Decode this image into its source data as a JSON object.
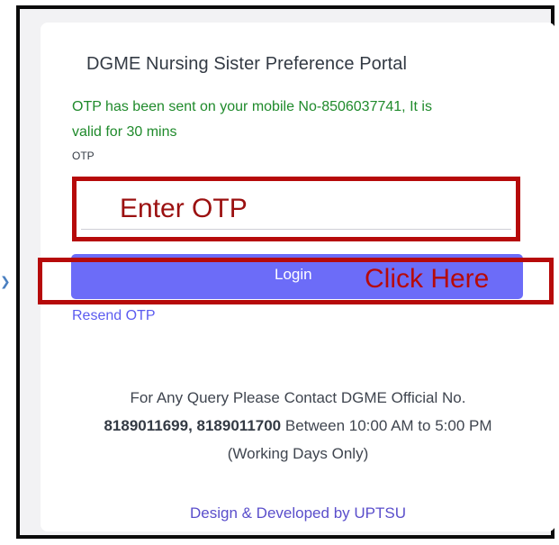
{
  "portal": {
    "title": "DGME Nursing Sister Preference Portal"
  },
  "otp": {
    "message": "OTP has been sent on your mobile No-8506037741, It is valid for 30 mins",
    "label": "OTP",
    "placeholder": "Enter OTP",
    "value": ""
  },
  "login": {
    "button_label": "Login",
    "annotation": "Click Here",
    "resend_label": "Resend OTP"
  },
  "contact": {
    "line1": "For Any Query Please Contact DGME Official No.",
    "numbers": "8189011699, 8189011700",
    "hours": " Between 10:00 AM to 5:00 PM",
    "note": "(Working Days Only)"
  },
  "footer": {
    "credit": "Design & Developed by UPTSU"
  },
  "colors": {
    "accent": "#6c6cf8",
    "success_text": "#1f8a2b",
    "annotation_red": "#b60a0a"
  },
  "icons": {
    "side_marker": "chevron-right-icon"
  }
}
